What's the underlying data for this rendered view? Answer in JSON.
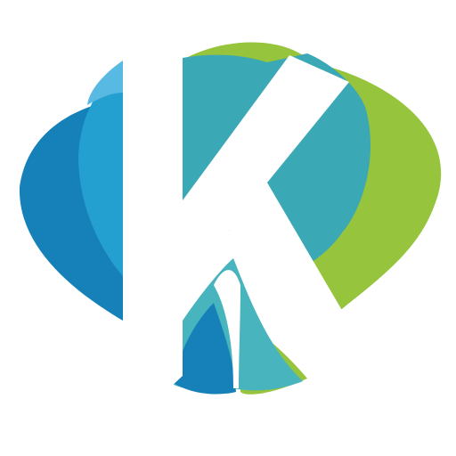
{
  "logo": {
    "icon": "k-logo-icon",
    "letter": "K",
    "colors": {
      "dark_blue": "#1581B8",
      "mid_blue": "#239FD0",
      "light_blue": "#58B9E2",
      "teal": "#3AA8B5",
      "teal_light": "#48B4BE",
      "green": "#96C43C",
      "white": "#FFFFFF"
    }
  }
}
